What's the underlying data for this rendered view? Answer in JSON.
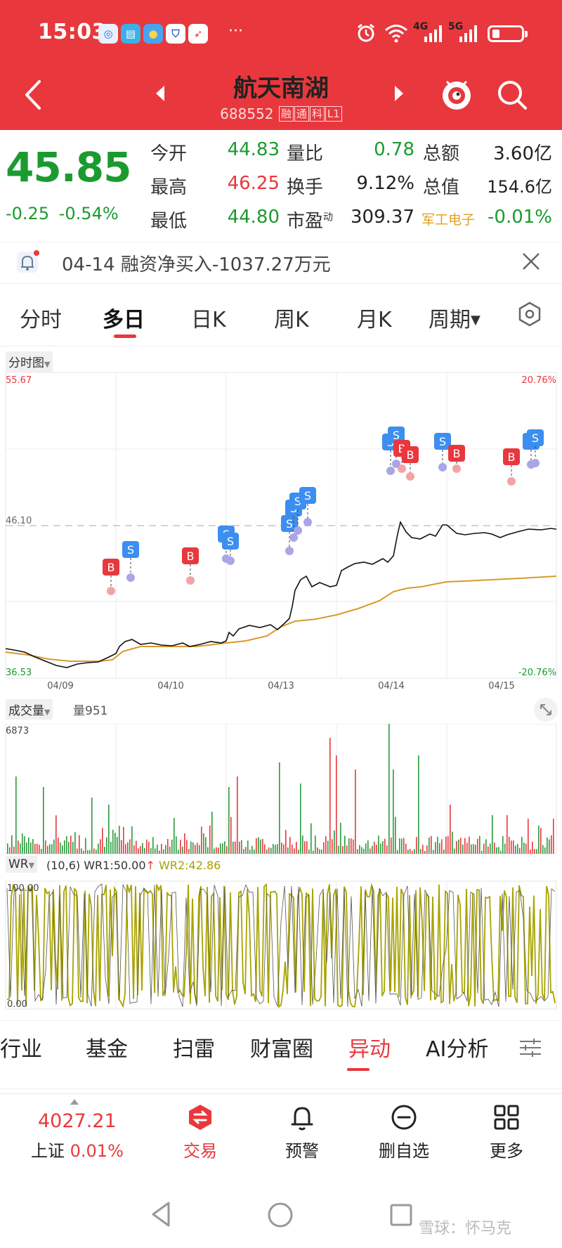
{
  "status_bar": {
    "time": "15:03",
    "more": "···",
    "network_1": "4G",
    "network_2": "5G",
    "icons": [
      "app-icon-1",
      "book-app-icon",
      "weather-app-icon",
      "shield-app-icon",
      "red-app-icon",
      "alarm-icon",
      "wifi-icon",
      "signal-icon",
      "battery-icon"
    ]
  },
  "header": {
    "stock_name": "航天南湖",
    "stock_code": "688552",
    "tags": [
      "融",
      "通",
      "科",
      "L1"
    ]
  },
  "quote": {
    "price": "45.85",
    "change": "-0.25",
    "change_pct": "-0.54%",
    "rows": [
      {
        "l1": "今开",
        "v1": "44.83",
        "l2": "量比",
        "v2": "0.78",
        "l3": "总额",
        "v3": "3.60亿"
      },
      {
        "l1": "最高",
        "v1": "46.25",
        "l2": "换手",
        "v2": "9.12%",
        "l3": "总值",
        "v3": "154.6亿"
      },
      {
        "l1": "最低",
        "v1": "44.80",
        "l2": "市盈",
        "l2_sup": "动",
        "v2": "309.37",
        "l3": "军工电子",
        "v3": "-0.01%"
      }
    ],
    "colors": {
      "up": "#e8383d",
      "down": "#1a9b2f"
    }
  },
  "notice": {
    "text": "04-14 融资净买入-1037.27万元"
  },
  "tabs": {
    "items": [
      "分时",
      "多日",
      "日K",
      "周K",
      "月K",
      "周期"
    ],
    "active": "多日"
  },
  "main_chart": {
    "selector": "分时图",
    "y_top": "55.67",
    "y_mid": "46.10",
    "y_bottom": "36.53",
    "pct_top": "20.76%",
    "pct_bottom": "-20.76%",
    "dates": [
      "04/09",
      "04/10",
      "04/13",
      "04/14",
      "04/15"
    ],
    "markers": {
      "buy": "B",
      "sell": "S"
    }
  },
  "volume_chart": {
    "selector": "成交量",
    "label": "量951",
    "y_max": "6873"
  },
  "wr_chart": {
    "selector": "WR",
    "params": "(10,6)",
    "wr1": "WR1:50.00",
    "wr2": "WR2:42.86",
    "y_top": "100.00",
    "y_bottom": "0.00"
  },
  "sub_tabs": {
    "items": [
      "行业",
      "基金",
      "扫雷",
      "财富圈",
      "异动",
      "AI分析"
    ],
    "active": "异动"
  },
  "bottom_nav": {
    "index_value": "4027.21",
    "index_name": "上证",
    "index_change": "0.01%",
    "items": [
      "交易",
      "预警",
      "删自选",
      "更多"
    ]
  },
  "watermark": "雪球：怀马克"
}
